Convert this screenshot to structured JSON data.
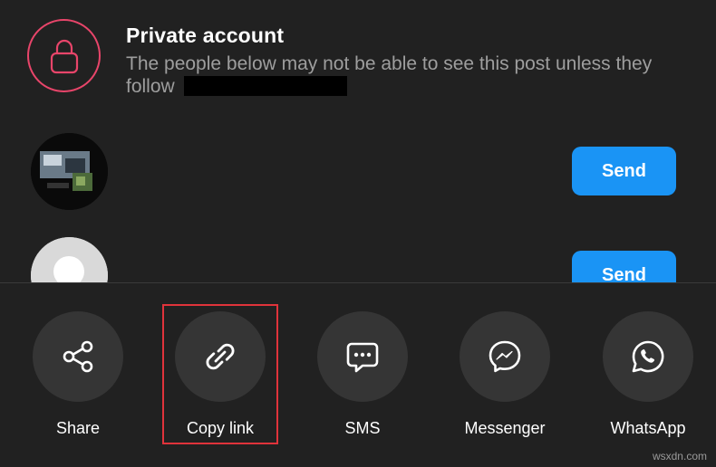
{
  "private_notice": {
    "title": "Private account",
    "description": "The people below may not be able to see this post unless they follow"
  },
  "recipients": [
    {
      "send_label": "Send"
    },
    {
      "send_label": "Send"
    }
  ],
  "share_options": [
    {
      "label": "Share",
      "icon": "share-icon"
    },
    {
      "label": "Copy link",
      "icon": "link-icon",
      "highlighted": true
    },
    {
      "label": "SMS",
      "icon": "sms-icon"
    },
    {
      "label": "Messenger",
      "icon": "messenger-icon"
    },
    {
      "label": "WhatsApp",
      "icon": "whatsapp-icon"
    }
  ],
  "colors": {
    "background": "#212121",
    "accent_send": "#1a94f5",
    "lock_ring": "#e8456a",
    "highlight_box": "#e0333b",
    "icon_circle": "#353535"
  },
  "watermark": "wsxdn.com"
}
